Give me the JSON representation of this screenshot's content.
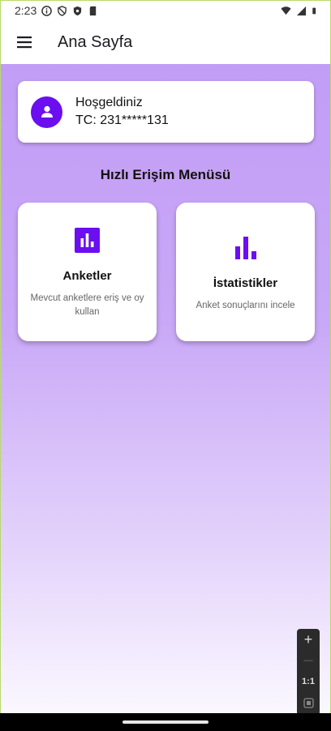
{
  "status_bar": {
    "time": "2:23"
  },
  "app_bar": {
    "title": "Ana Sayfa"
  },
  "welcome": {
    "greeting": "Hoşgeldiniz",
    "tc": "TC: 231*****131"
  },
  "quick_menu": {
    "title": "Hızlı Erişim Menüsü",
    "cards": [
      {
        "title": "Anketler",
        "description": "Mevcut anketlere eriş ve oy kullan",
        "icon": "poll-icon"
      },
      {
        "title": "İstatistikler",
        "description": "Anket sonuçlarını incele",
        "icon": "bar-chart-icon"
      }
    ]
  },
  "zoom": {
    "in": "+",
    "out": "—",
    "reset": "1:1"
  },
  "colors": {
    "accent": "#6b0ef0",
    "gradient_top": "#c29df6",
    "gradient_bottom": "#fbf8ff"
  }
}
